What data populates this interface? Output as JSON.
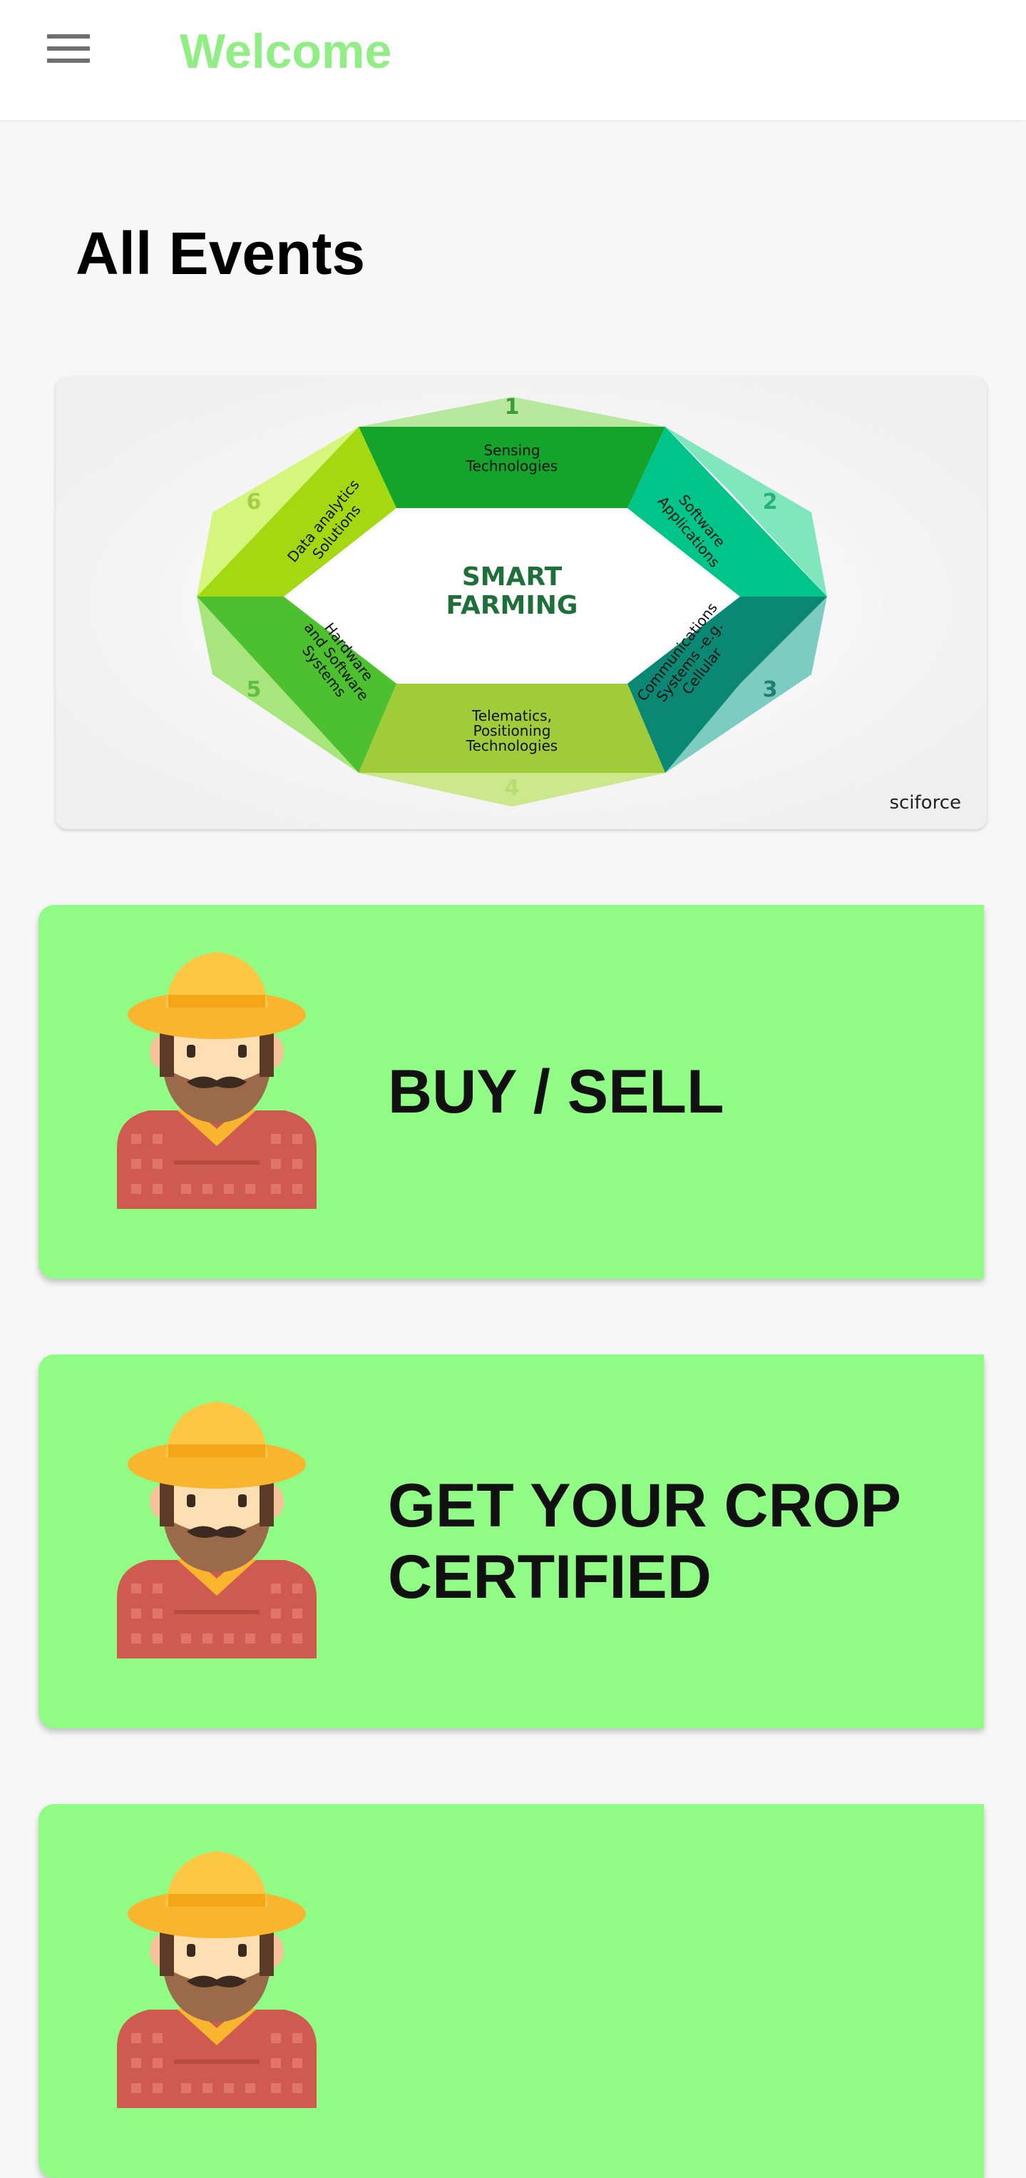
{
  "appbar": {
    "title": "Welcome",
    "menu_icon": "hamburger-menu-icon"
  },
  "section": {
    "title": "All Events"
  },
  "banner": {
    "center_title_line1": "SMART",
    "center_title_line2": "FARMING",
    "segments": [
      {
        "number": "1",
        "text_lines": [
          "Sensing",
          "Technologies"
        ]
      },
      {
        "number": "2",
        "text_lines": [
          "Software",
          "Applications"
        ]
      },
      {
        "number": "3",
        "text_lines": [
          "Communications",
          "Systems -e.g.",
          "Cellular"
        ]
      },
      {
        "number": "4",
        "text_lines": [
          "Telematics,",
          "Positioning",
          "Technologies"
        ]
      },
      {
        "number": "5",
        "text_lines": [
          "Hardware",
          "and Software",
          "Systems"
        ]
      },
      {
        "number": "6",
        "text_lines": [
          "Data analytics",
          "Solutions"
        ]
      }
    ],
    "brand": "sciforce"
  },
  "cards": [
    {
      "label": "BUY / SELL",
      "icon": "farmer-avatar-icon"
    },
    {
      "label": "GET YOUR CROP CERTIFIED",
      "icon": "farmer-avatar-icon"
    },
    {
      "label": "",
      "icon": "farmer-avatar-icon"
    }
  ],
  "colors": {
    "accent": "#90ee85",
    "card_bg": "#90fc86",
    "page_bg": "#f7f7f7"
  }
}
